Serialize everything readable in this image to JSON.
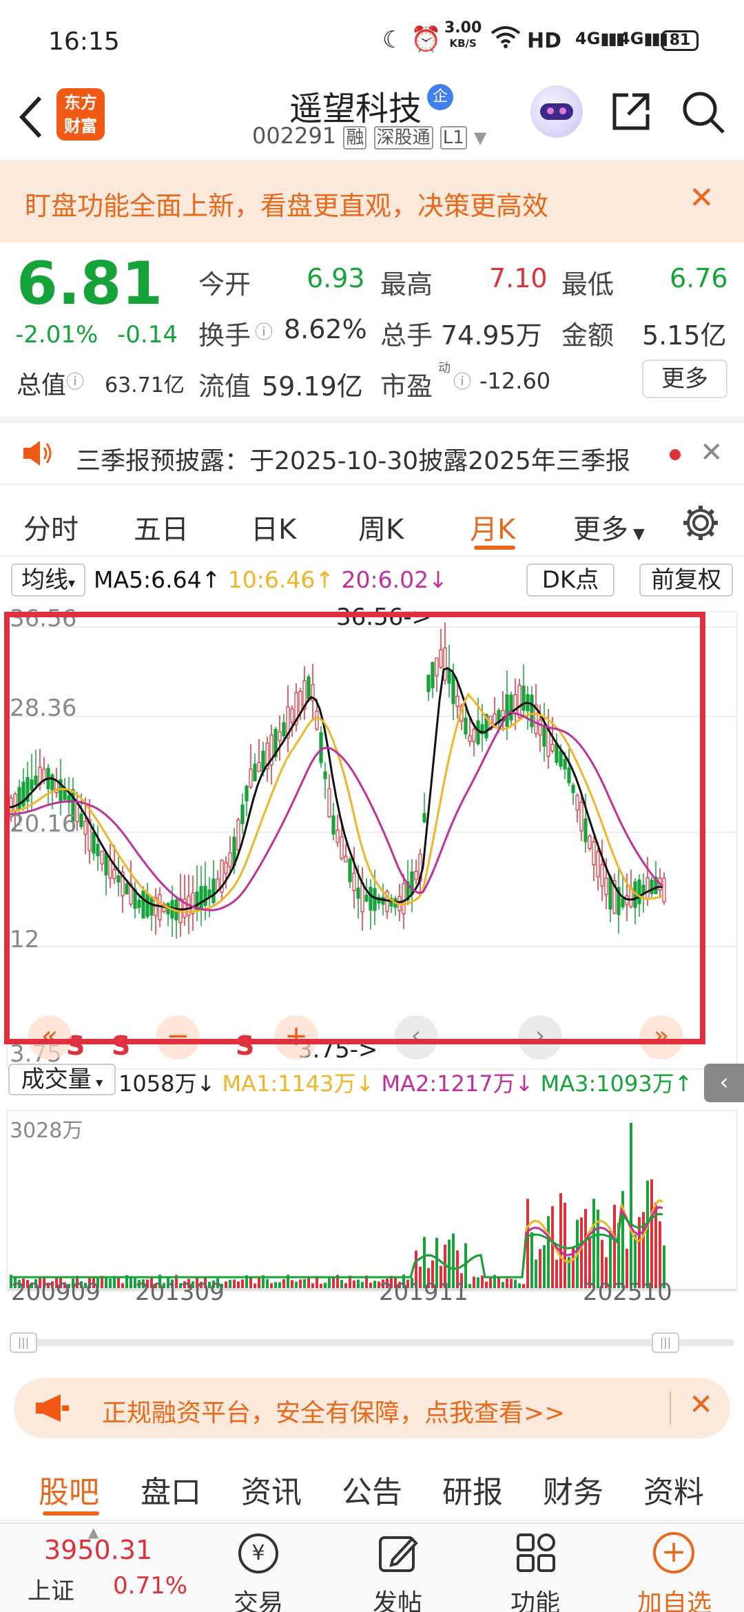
{
  "status": {
    "time": "16:15",
    "speed": "3.00",
    "speed_unit": "KB/S",
    "hd": "HD",
    "net1": "4G",
    "net2": "4G",
    "battery": "81"
  },
  "header": {
    "stock_name": "遥望科技",
    "qi_badge": "企",
    "code": "002291",
    "tags": [
      "融",
      "深股通",
      "L1"
    ],
    "logo_line1": "东方",
    "logo_line2": "财富"
  },
  "banner": {
    "text": "盯盘功能全面上新，看盘更直观，决策更高效"
  },
  "quote": {
    "price": "6.81",
    "change_pct": "-2.01%",
    "change": "-0.14",
    "open_label": "今开",
    "open": "6.93",
    "high_label": "最高",
    "high": "7.10",
    "low_label": "最低",
    "low": "6.76",
    "turnover_label": "换手",
    "turnover": "8.62%",
    "volume_label": "总手",
    "volume": "74.95万",
    "amount_label": "金额",
    "amount": "5.15亿",
    "mktcap_label": "总值",
    "mktcap": "63.71亿",
    "float_label": "流值",
    "float_cap": "59.19亿",
    "pe_label": "市盈",
    "pe_sup": "动",
    "pe": "-12.60",
    "more": "更多"
  },
  "notice": {
    "text": "三季报预披露：于2025-10-30披露2025年三季报"
  },
  "tabs": [
    "分时",
    "五日",
    "日K",
    "周K",
    "月K",
    "更多"
  ],
  "chart": {
    "ma_selector": "均线",
    "ma5": "MA5:6.64↑",
    "ma10": "10:6.46↑",
    "ma20": "20:6.02↓",
    "dk": "DK点",
    "fuquan": "前复权",
    "y_labels": [
      "36.56",
      "28.36",
      "20.16",
      "12",
      "3.75"
    ],
    "max_marker": "36.56->",
    "min_marker": "3.75->",
    "vol_selector": "成交量",
    "vol_value": "1058万↓",
    "vma1": "MA1:1143万↓",
    "vma2": "MA2:1217万↓",
    "vma3": "MA3:1093万↑",
    "vol_max": "3028万",
    "x_labels": [
      "200909",
      "201309",
      "201911",
      "202510"
    ],
    "s_marks": [
      "S",
      "S",
      "S"
    ],
    "colors": {
      "up": "#e0303a",
      "down": "#15a33a",
      "ma5": "#111111",
      "ma10": "#f0b429",
      "ma20": "#c0309a",
      "highlight": "#e03040"
    }
  },
  "chart_data": {
    "type": "candlestick",
    "title": "",
    "ylim": [
      3.75,
      36.56
    ],
    "series": [
      {
        "name": "MA5",
        "values": []
      },
      {
        "name": "MA10",
        "values": []
      },
      {
        "name": "MA20",
        "values": []
      }
    ]
  },
  "bottom_banner": {
    "text": "正规融资平台，安全有保障，点我查看>>"
  },
  "subtabs": [
    "股吧",
    "盘口",
    "资讯",
    "公告",
    "研报",
    "财务",
    "资料"
  ],
  "bottom_nav": {
    "index_value": "3950.31",
    "index_name": "上证",
    "index_pct": "0.71%",
    "trade": "交易",
    "post": "发帖",
    "func": "功能",
    "add": "加自选"
  }
}
